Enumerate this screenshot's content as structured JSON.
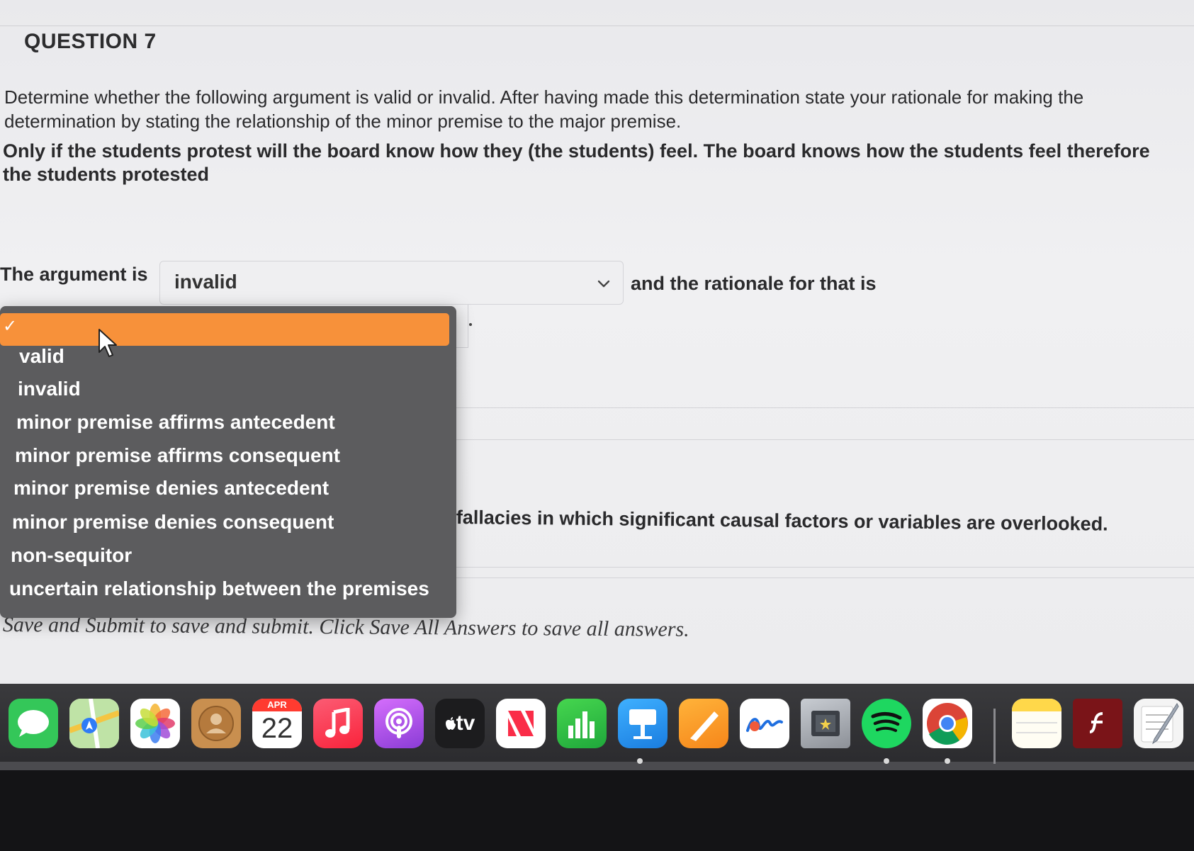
{
  "question": {
    "title": "QUESTION 7",
    "instructions": "Determine whether the following argument is valid or invalid.  After having made this determination state your rationale for making the determination by stating the relationship of the minor premise to the major premise.",
    "argument": "Only if the students protest will the board know how they (the students) feel.  The board knows how the students feel therefore the students protested"
  },
  "answer": {
    "prompt_label": "The argument is",
    "selected_value": "invalid",
    "rationale_label": "and the rationale for that is",
    "fallacy_text": "fallacies in which significant causal factors or variables are overlooked."
  },
  "dropdown": {
    "checked_option": "✓",
    "options": [
      "valid",
      "invalid",
      "minor premise affirms antecedent",
      "minor premise affirms consequent",
      "minor premise denies antecedent",
      "minor premise denies consequent",
      "non-sequitor",
      "uncertain relationship between the premises"
    ],
    "highlight_color": "#f7913a"
  },
  "footer": {
    "note": "Save and Submit to save and submit. Click Save All Answers to save all answers."
  },
  "dock": {
    "calendar_month": "APR",
    "calendar_day": "22",
    "tv_label": "tv",
    "apps": [
      "messages-icon",
      "maps-icon",
      "photos-icon",
      "contacts-icon",
      "calendar-icon",
      "music-icon",
      "podcasts-icon",
      "apple-tv-icon",
      "news-icon",
      "numbers-icon",
      "keynote-icon",
      "pages-icon",
      "freeform-icon",
      "image-capture-icon",
      "spotify-icon",
      "chrome-icon",
      "notes-icon",
      "flash-icon",
      "textedit-icon"
    ]
  }
}
